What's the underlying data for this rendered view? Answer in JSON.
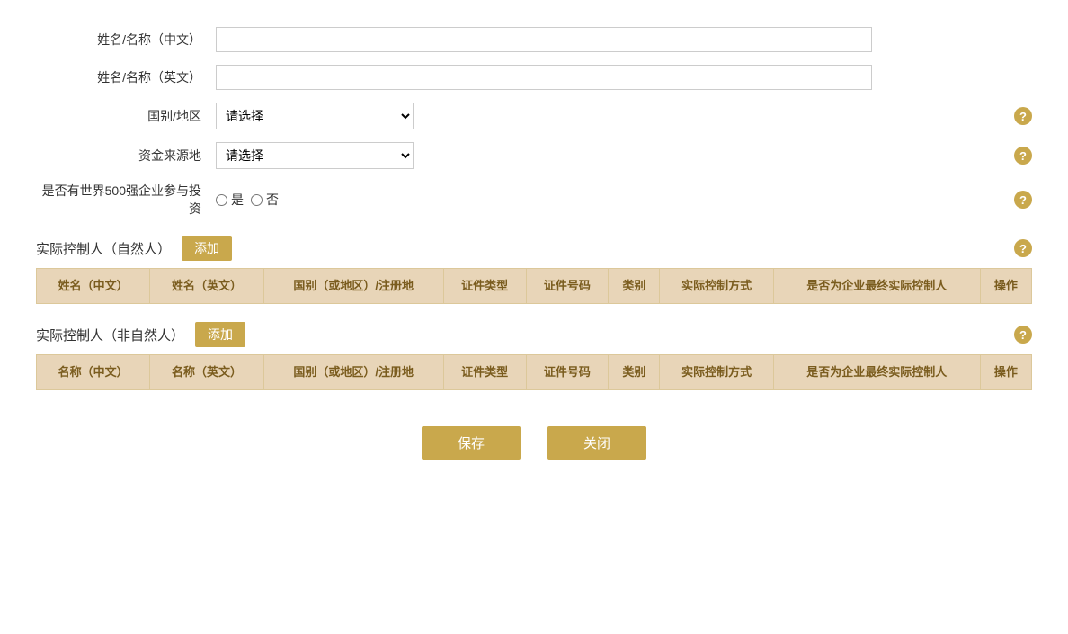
{
  "form": {
    "name_cn_label": "姓名/名称（中文）",
    "name_en_label": "姓名/名称（英文）",
    "country_label": "国别/地区",
    "fund_source_label": "资金来源地",
    "world500_label": "是否有世界500强企业参与投资",
    "country_placeholder": "请选择",
    "fund_source_placeholder": "请选择",
    "yes_label": "是",
    "no_label": "否"
  },
  "natural_person": {
    "title": "实际控制人（自然人）",
    "add_label": "添加",
    "columns": [
      "姓名（中文）",
      "姓名（英文）",
      "国别（或地区）/注册地",
      "证件类型",
      "证件号码",
      "类别",
      "实际控制方式",
      "是否为企业最终实际控制人",
      "操作"
    ]
  },
  "non_natural_person": {
    "title": "实际控制人（非自然人）",
    "add_label": "添加",
    "columns": [
      "名称（中文）",
      "名称（英文）",
      "国别（或地区）/注册地",
      "证件类型",
      "证件号码",
      "类别",
      "实际控制方式",
      "是否为企业最终实际控制人",
      "操作"
    ]
  },
  "buttons": {
    "save": "保存",
    "close": "关闭"
  },
  "icons": {
    "help": "?",
    "dropdown": "▾"
  }
}
